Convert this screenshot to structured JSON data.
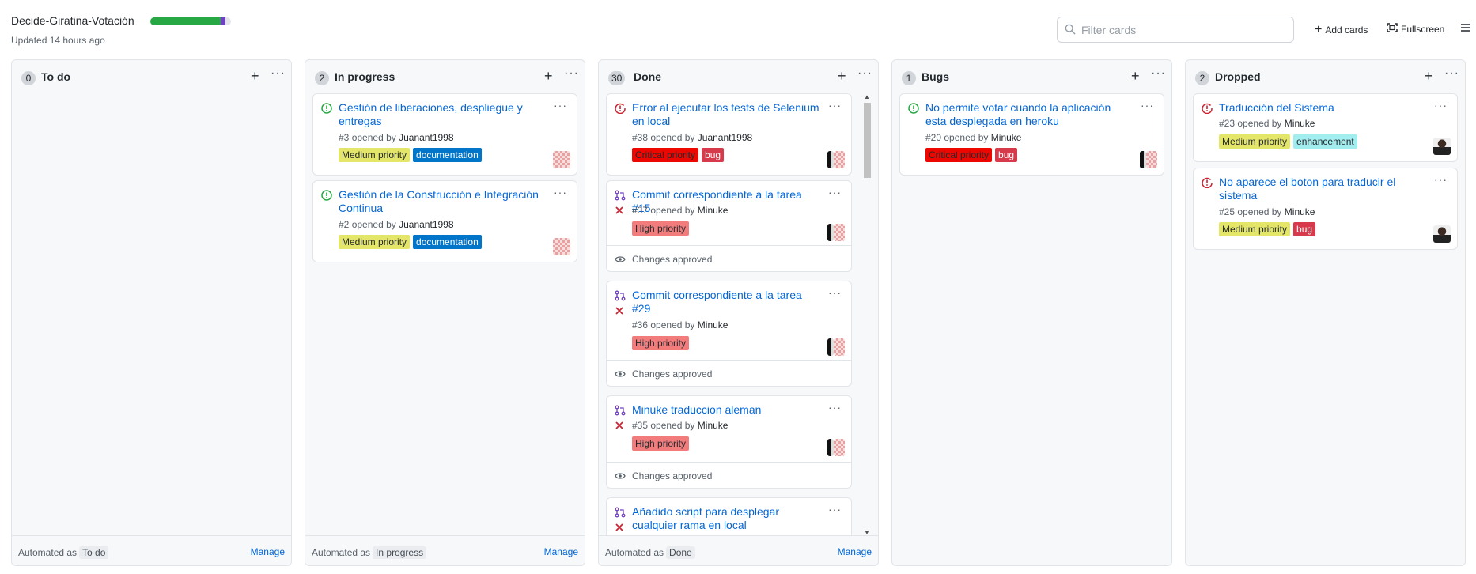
{
  "project": {
    "title": "Decide-Giratina-Votación",
    "updated": "Updated 14 hours ago",
    "progress": {
      "done": 0.87,
      "in_progress": 0.06,
      "colors": {
        "done": "#28a745",
        "in_progress": "#6f42c1"
      }
    }
  },
  "toolbar": {
    "filter_placeholder": "Filter cards",
    "add_cards": "Add cards",
    "fullscreen": "Fullscreen"
  },
  "columns": [
    {
      "name": "To do",
      "count": "0",
      "automated_prefix": "Automated as",
      "automated": "To do",
      "manage": "Manage"
    },
    {
      "name": "In progress",
      "count": "2",
      "automated_prefix": "Automated as",
      "automated": "In progress",
      "manage": "Manage"
    },
    {
      "name": "Done",
      "count": "30",
      "automated_prefix": "Automated as",
      "automated": "Done",
      "manage": "Manage"
    },
    {
      "name": "Bugs",
      "count": "1"
    },
    {
      "name": "Dropped",
      "count": "2"
    }
  ],
  "cards": {
    "inprogress": [
      {
        "title": "Gestión de liberaciones, despliegue y entregas",
        "number": "#3",
        "opened_by": "opened by",
        "author": "Juanant1998",
        "labels": [
          "Medium priority",
          "documentation"
        ]
      },
      {
        "title": "Gestión de la Construcción e Integración Continua",
        "number": "#2",
        "opened_by": "opened by",
        "author": "Juanant1998",
        "labels": [
          "Medium priority",
          "documentation"
        ]
      }
    ],
    "done": [
      {
        "title": "Error al ejecutar los tests de Selenium en local",
        "number": "#38",
        "opened_by": "opened by",
        "author": "Juanant1998",
        "labels": [
          "Critical priority",
          "bug"
        ]
      },
      {
        "title": "Commit correspondiente a la tarea #15",
        "number": "#37",
        "opened_by": "opened by",
        "author": "Minuke",
        "labels": [
          "High priority"
        ],
        "review": "Changes approved"
      },
      {
        "title": "Commit correspondiente a la tarea #29",
        "number": "#36",
        "opened_by": "opened by",
        "author": "Minuke",
        "labels": [
          "High priority"
        ],
        "review": "Changes approved"
      },
      {
        "title": "Minuke traduccion aleman",
        "number": "#35",
        "opened_by": "opened by",
        "author": "Minuke",
        "labels": [
          "High priority"
        ],
        "review": "Changes approved"
      },
      {
        "title": "Añadido script para desplegar cualquier rama en local"
      }
    ],
    "bugs": [
      {
        "title": "No permite votar cuando la aplicación esta desplegada en heroku",
        "number": "#20",
        "opened_by": "opened by",
        "author": "Minuke",
        "labels": [
          "Critical priority",
          "bug"
        ]
      }
    ],
    "dropped": [
      {
        "title": "Traducción del Sistema",
        "number": "#23",
        "opened_by": "opened by",
        "author": "Minuke",
        "labels": [
          "Medium priority",
          "enhancement"
        ]
      },
      {
        "title": "No aparece el boton para traducir el sistema",
        "number": "#25",
        "opened_by": "opened by",
        "author": "Minuke",
        "labels": [
          "Medium priority",
          "bug"
        ]
      }
    ]
  },
  "label_colors": {
    "medium": {
      "bg": "#e4e669",
      "fg": "#24292e"
    },
    "documentation": {
      "bg": "#0075ca",
      "fg": "#ffffff"
    },
    "critical": {
      "bg": "#ee0701",
      "fg": "#24292e"
    },
    "bug": {
      "bg": "#d73a4a",
      "fg": "#ffffff"
    },
    "high": {
      "bg": "#f27c7c",
      "fg": "#24292e"
    },
    "enhancement": {
      "bg": "#a2eeef",
      "fg": "#24292e"
    }
  },
  "icons": {
    "issue_open": "issue-opened-icon",
    "issue_closed": "issue-closed-icon",
    "pull_request": "git-pull-request-icon",
    "failed": "x-icon",
    "review": "eye-icon"
  }
}
